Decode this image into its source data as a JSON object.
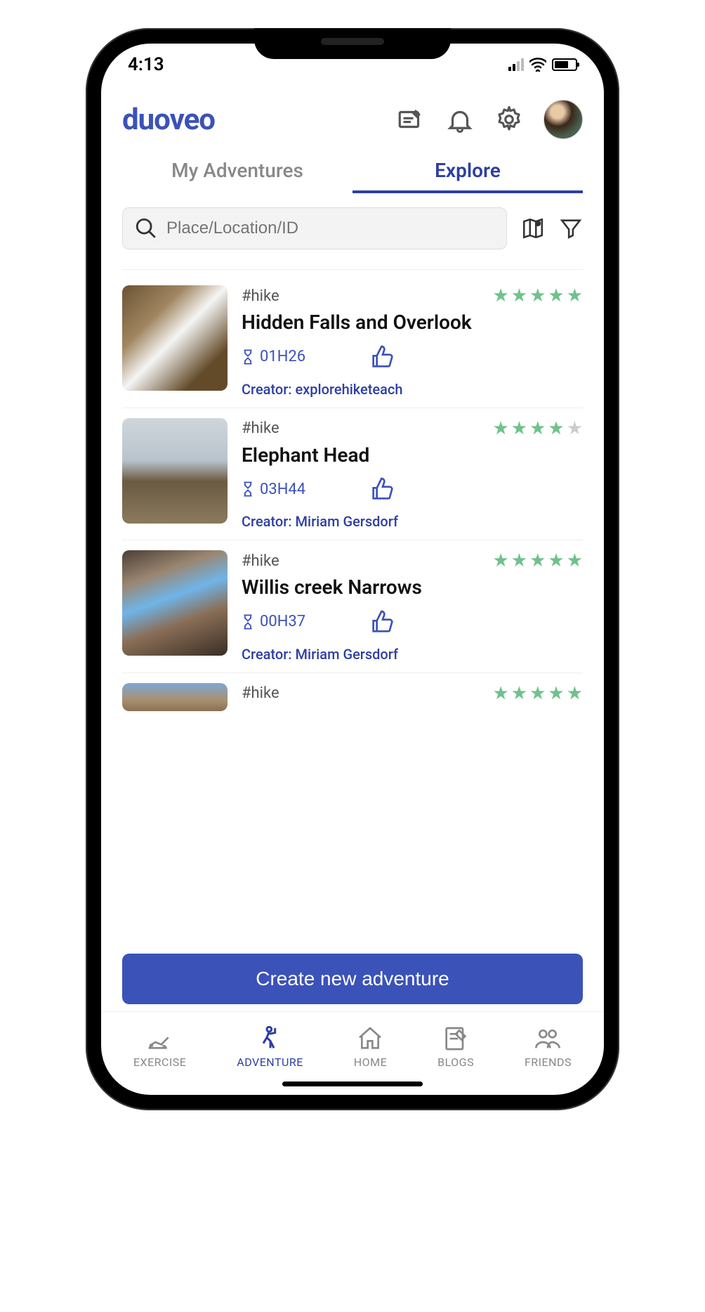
{
  "status": {
    "time": "4:13"
  },
  "header": {
    "logo": "duoveo"
  },
  "tabs": {
    "my": "My Adventures",
    "explore": "Explore",
    "active": "explore"
  },
  "search": {
    "placeholder": "Place/Location/ID"
  },
  "items": [
    {
      "tag": "#hike",
      "rating": 5,
      "title": "Hidden Falls and Overlook",
      "duration": "01H26",
      "creator": "Creator: explorehiketeach"
    },
    {
      "tag": "#hike",
      "rating": 4,
      "title": "Elephant Head",
      "duration": "03H44",
      "creator": "Creator: Miriam Gersdorf"
    },
    {
      "tag": "#hike",
      "rating": 5,
      "title": "Willis creek Narrows",
      "duration": "00H37",
      "creator": "Creator: Miriam Gersdorf"
    },
    {
      "tag": "#hike",
      "rating": 5,
      "title": "",
      "duration": "",
      "creator": ""
    }
  ],
  "cta": {
    "label": "Create new adventure"
  },
  "nav": {
    "exercise": "EXERCISE",
    "adventure": "ADVENTURE",
    "home": "HOME",
    "blogs": "BLOGS",
    "friends": "FRIENDS",
    "active": "adventure"
  }
}
